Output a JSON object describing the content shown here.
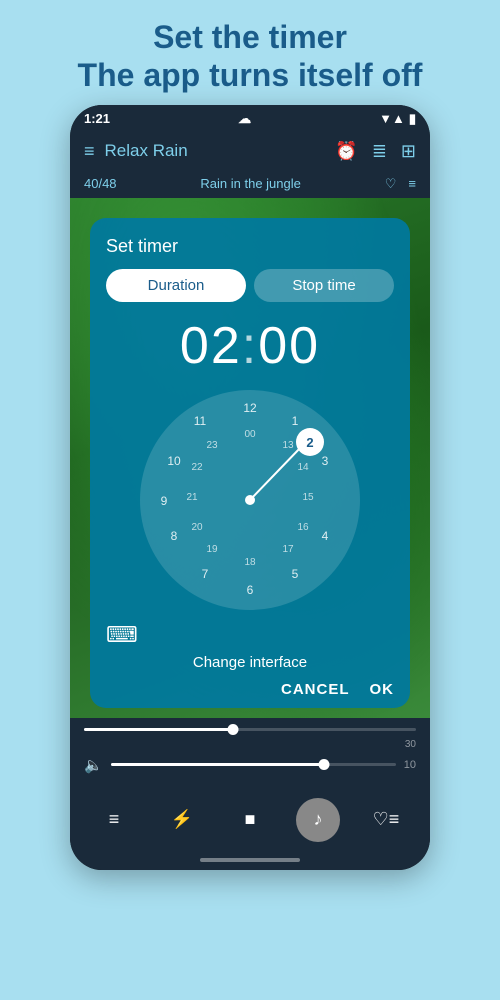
{
  "header": {
    "line1": "Set the timer",
    "line2": "The app turns itself off"
  },
  "status_bar": {
    "time": "1:21",
    "wifi_icon": "☁",
    "signal_icon": "▲",
    "battery_icon": "▮"
  },
  "app_header": {
    "menu_icon": "≡",
    "title": "Relax Rain",
    "alarm_icon": "⏰",
    "list_icon": "≣",
    "grid_icon": "⊞"
  },
  "track_bar": {
    "position": "40/48",
    "track_name": "Rain in the jungle",
    "heart_icon": "♡",
    "playlist_icon": "≡"
  },
  "timer_dialog": {
    "title": "Set timer",
    "tab_duration": "Duration",
    "tab_stop": "Stop time",
    "time_value": "02",
    "time_colon": ":",
    "time_minutes": "00",
    "clock_numbers_outer": [
      "12",
      "1",
      "2",
      "3",
      "4",
      "5",
      "6",
      "7",
      "8",
      "9",
      "10",
      "11"
    ],
    "clock_numbers_inner": [
      "00",
      "13",
      "14",
      "15",
      "16",
      "17",
      "18",
      "19",
      "20",
      "21",
      "22",
      "23"
    ],
    "selected_number": "2",
    "keyboard_icon": "⌨",
    "change_interface": "Change interface",
    "cancel_btn": "CANCEL",
    "ok_btn": "OK"
  },
  "player": {
    "time_start": "",
    "time_end": "30",
    "volume_icon": "🔈",
    "volume_level": "10"
  },
  "bottom_nav": {
    "list_icon": "≡",
    "bolt_icon": "⚡",
    "stop_icon": "■",
    "music_icon": "♪",
    "favorites_icon": "≡♡"
  }
}
